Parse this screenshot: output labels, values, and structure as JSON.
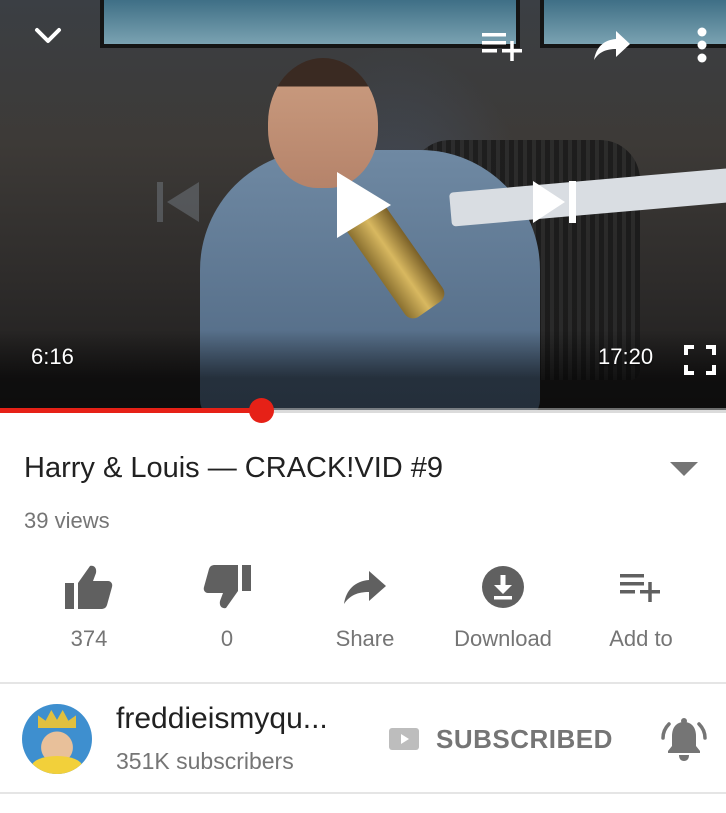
{
  "player": {
    "current_time": "6:16",
    "duration": "17:20",
    "progress_fraction": 0.359,
    "icons": {
      "collapse": "chevron-down-icon",
      "add_to_queue": "playlist-add-icon",
      "share": "share-arrow-icon",
      "more": "more-vert-icon",
      "previous": "skip-previous-icon",
      "play": "play-icon",
      "next": "skip-next-icon",
      "fullscreen": "fullscreen-icon"
    }
  },
  "video": {
    "title": "Harry & Louis — CRACK!VID #9",
    "views": "39 views"
  },
  "actions": [
    {
      "id": "like",
      "icon": "thumbs-up-icon",
      "label": "374"
    },
    {
      "id": "dislike",
      "icon": "thumbs-down-icon",
      "label": "0"
    },
    {
      "id": "share",
      "icon": "share-arrow-icon",
      "label": "Share"
    },
    {
      "id": "download",
      "icon": "download-icon",
      "label": "Download"
    },
    {
      "id": "add_to",
      "icon": "playlist-add-icon",
      "label": "Add to"
    }
  ],
  "channel": {
    "name": "freddieismyqu...",
    "subscribers": "351K subscribers",
    "subscribe_label": "SUBSCRIBED",
    "subscribe_icon": "youtube-play-icon",
    "notification_icon": "bell-ringing-icon"
  },
  "colors": {
    "accent_red": "#e62117",
    "text_primary": "#212121",
    "text_secondary": "#757575",
    "icon_gray": "#606060",
    "divider": "#e5e5e5"
  }
}
